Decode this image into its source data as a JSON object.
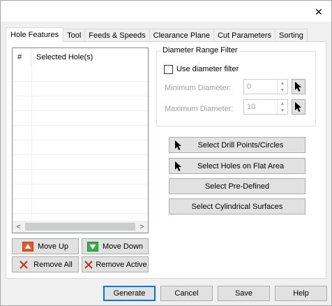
{
  "window": {
    "close_glyph": "✕"
  },
  "tabs": [
    {
      "label": "Hole Features",
      "active": true
    },
    {
      "label": "Tool"
    },
    {
      "label": "Feeds & Speeds"
    },
    {
      "label": "Clearance Plane"
    },
    {
      "label": "Cut Parameters"
    },
    {
      "label": "Sorting"
    }
  ],
  "hole_list": {
    "columns": [
      "#",
      "Selected Hole(s)"
    ],
    "scroll_left": "<",
    "scroll_right": ">"
  },
  "list_buttons": {
    "move_up": "Move Up",
    "move_down": "Move Down",
    "remove_all": "Remove All",
    "remove_active": "Remove Active"
  },
  "diameter_filter": {
    "title": "Diameter Range Filter",
    "use_filter_label": "Use diameter filter",
    "use_filter_checked": false,
    "min_label": "Minimum Diameter:",
    "min_value": "0",
    "max_label": "Maximum Diameter:",
    "max_value": "10"
  },
  "select_buttons": {
    "drill_points": "Select Drill Points/Circles",
    "flat_area": "Select Holes on Flat Area",
    "pre_defined": "Select Pre-Defined",
    "cylindrical": "Select Cylindrical Surfaces"
  },
  "footer": {
    "generate": "Generate",
    "cancel": "Cancel",
    "save": "Save",
    "help": "Help"
  },
  "colors": {
    "accent": "#0078d7",
    "arrow_up_icon": "#e8562a",
    "arrow_down_icon": "#3cb043",
    "remove_icon": "#c42b1c"
  }
}
